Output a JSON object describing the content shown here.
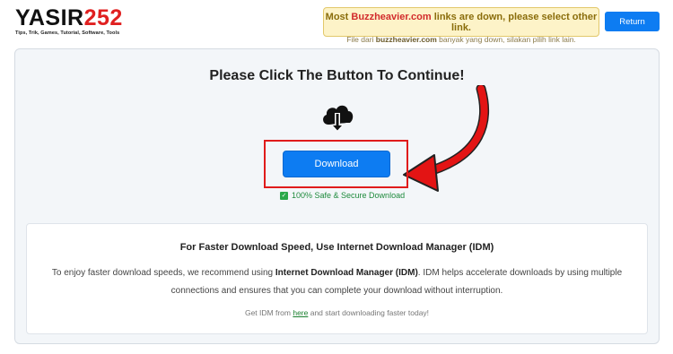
{
  "header": {
    "logo_prefix": "YASIR",
    "logo_suffix": "252",
    "logo_tagline": "Tips, Trik, Games, Tutorial,  Software, Tools",
    "notice_prefix": "Most ",
    "notice_site": "Buzzheavier.com",
    "notice_suffix": " links are down, please select other link.",
    "notice_sub_prefix": "File dari ",
    "notice_sub_site": "buzzheavier.com",
    "notice_sub_suffix": " banyak yang down, silakan pilih link lain.",
    "return_label": "Return"
  },
  "main": {
    "heading": "Please Click The Button To Continue!",
    "download_label": "Download",
    "secure_text": "100% Safe & Secure Download"
  },
  "info": {
    "title": "For Faster Download Speed, Use Internet Download Manager (IDM)",
    "text_prefix": "To enjoy faster download speeds, we recommend using ",
    "text_bold": "Internet Download Manager (IDM)",
    "text_suffix": ". IDM helps accelerate downloads by using multiple connections and ensures that you can complete your download without interruption.",
    "footer_prefix": "Get IDM from ",
    "footer_link": "here",
    "footer_suffix": " and start downloading faster today!"
  },
  "colors": {
    "accent": "#0d7cf2",
    "highlight": "#e01b1b",
    "secure": "#1e8a3c",
    "notice_bg": "#fdf3c8"
  },
  "icons": {
    "cloud": "cloud-download-icon",
    "check": "check-icon",
    "arrow": "curved-arrow-icon"
  }
}
